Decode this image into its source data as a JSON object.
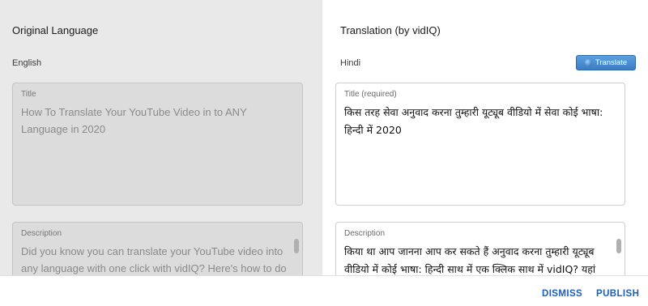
{
  "left": {
    "heading": "Original Language",
    "language": "English",
    "title_field": {
      "label": "Title",
      "value": "How To Translate Your YouTube Video in to ANY Language in 2020"
    },
    "description_field": {
      "label": "Description",
      "value": "Did you know you can translate your YouTube video into any language with one click with vidIQ? Here's how to do"
    }
  },
  "right": {
    "heading": "Translation (by vidIQ)",
    "language": "Hindi",
    "translate_button": {
      "label": "Translate",
      "icon": "globe-icon"
    },
    "title_field": {
      "label": "Title (required)",
      "value": "किस तरह सेवा अनुवाद करना तुम्हारी यूट्यूब वीडियो में सेवा कोई भाषा: हिन्दी में 2020"
    },
    "description_field": {
      "label": "Description",
      "value": "किया था आप जानना आप कर सकते हैं अनुवाद करना तुम्हारी यूट्यूब वीडियो में कोई भाषा: हिन्दी साथ में एक क्लिक साथ में vidIQ? यहां"
    }
  },
  "footer": {
    "dismiss_label": "DISMISS",
    "publish_label": "PUBLISH"
  },
  "colors": {
    "left_background": "#e9e9e9",
    "accent_blue": "#1a5fbf",
    "button_blue": "#3b7dc4"
  }
}
